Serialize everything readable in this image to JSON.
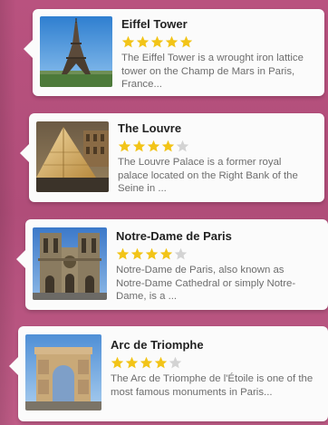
{
  "places": [
    {
      "title": "Eiffel Tower",
      "rating": 5,
      "max_rating": 5,
      "description": "The Eiffel Tower is a wrought iron lattice tower on the Champ de Mars in Paris, France...",
      "image": "eiffel-tower-photo"
    },
    {
      "title": "The Louvre",
      "rating": 4,
      "max_rating": 5,
      "description": "The Louvre Palace is a former royal palace located on the Right Bank of the Seine in ...",
      "image": "louvre-pyramid-photo"
    },
    {
      "title": "Notre-Dame de Paris",
      "rating": 4,
      "max_rating": 5,
      "description": "Notre-Dame de Paris, also known as Notre-Dame Cathedral or simply Notre-Dame, is a ...",
      "image": "notre-dame-photo"
    },
    {
      "title": "Arc de Triomphe",
      "rating": 4,
      "max_rating": 5,
      "description": "The Arc de Triomphe de l'Étoile is one of the most famous monuments in Paris...",
      "image": "arc-de-triomphe-photo"
    }
  ],
  "colors": {
    "background": "#b9527f",
    "star_filled": "#f2c418",
    "star_empty": "#d3d3d3",
    "card": "#fbfbfb"
  }
}
